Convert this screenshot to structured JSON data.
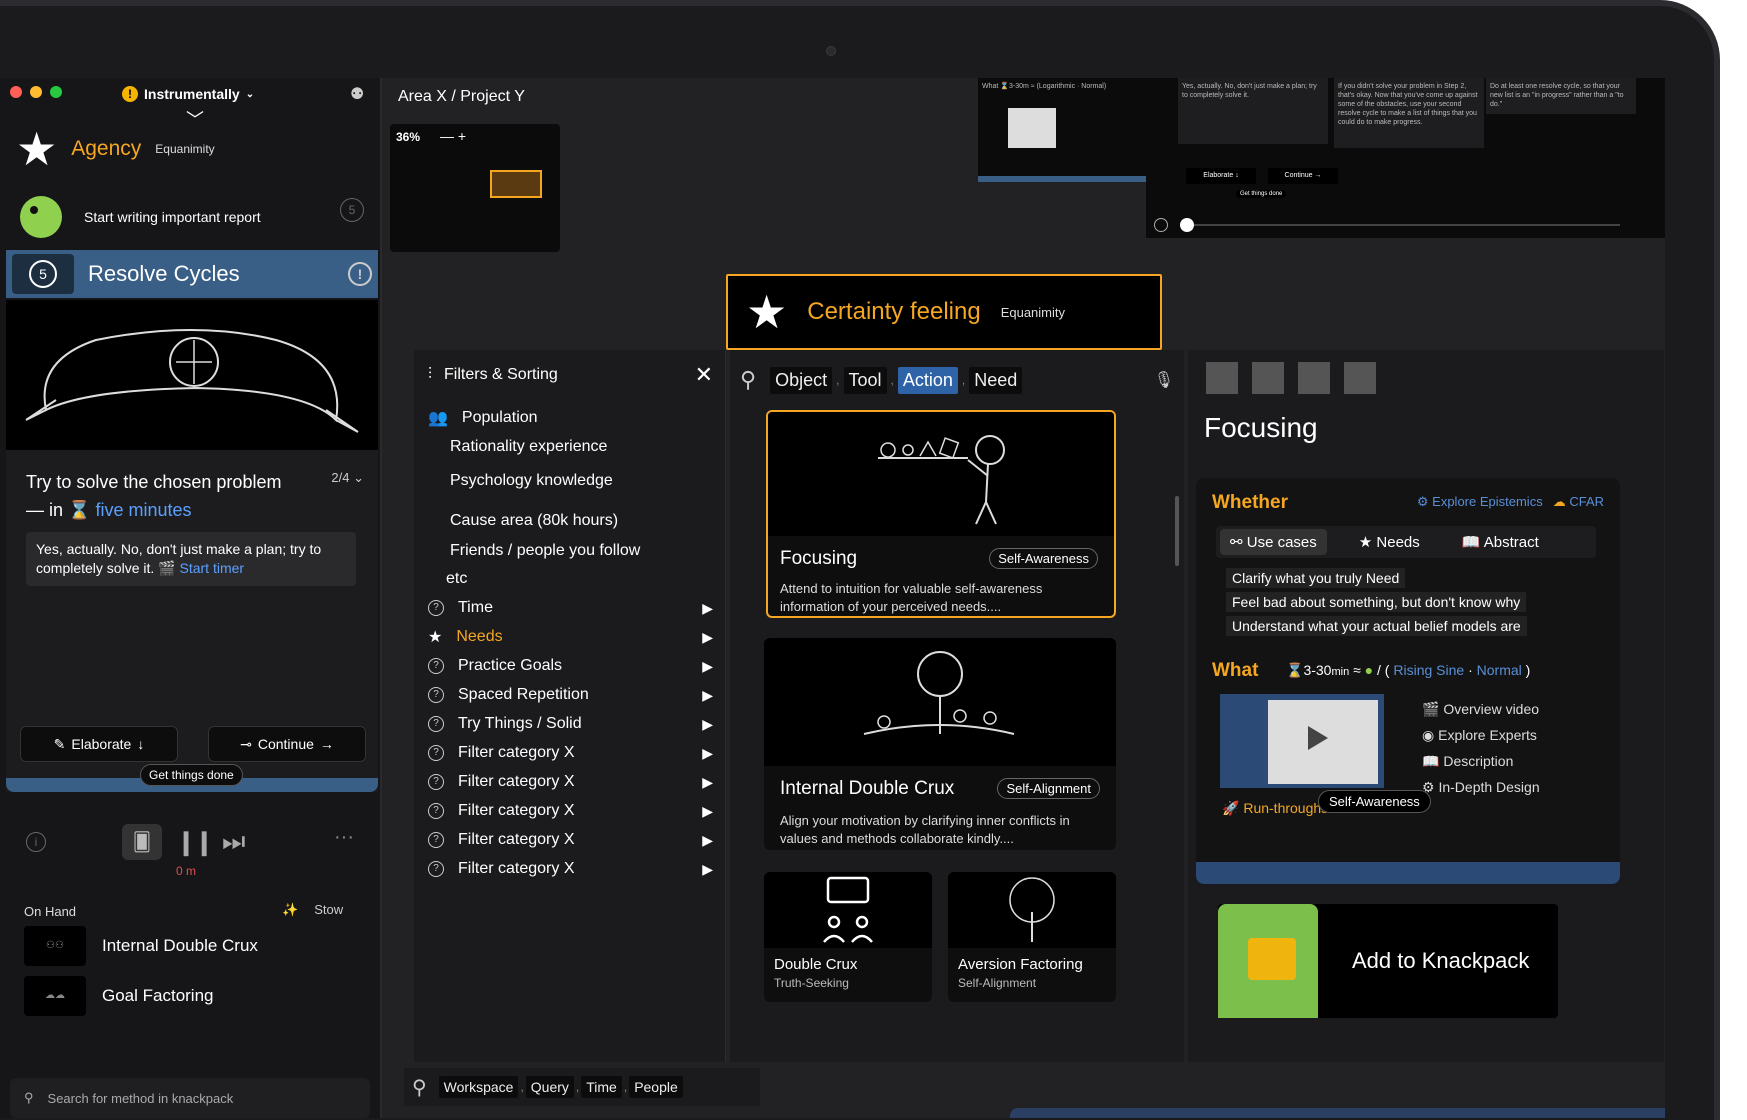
{
  "window": {
    "workspace_name": "Instrumentally",
    "traffic_colors": [
      "#ff5f57",
      "#febc2e",
      "#28c840"
    ]
  },
  "left": {
    "brand": {
      "title": "Agency",
      "subtitle": "Equanimity"
    },
    "next_task": {
      "label": "Start writing important report",
      "cycle_count": "5"
    },
    "resolve": {
      "label": "Resolve Cycles",
      "cycle_count": "5"
    },
    "task": {
      "title": "Try to solve the chosen problem",
      "title_prefix": "— in",
      "duration": "five minutes",
      "progress": "2/4",
      "note": "Yes, actually. No, don't just make a plan; try to completely solve it.",
      "timer_label": "Start timer"
    },
    "elaborate_label": "Elaborate",
    "continue_label": "Continue",
    "get_things_done": "Get things done",
    "player_time": "0 m",
    "on_hand_title": "On Hand",
    "stow_label": "Stow",
    "on_hand_items": [
      {
        "label": "Internal Double Crux"
      },
      {
        "label": "Goal Factoring"
      }
    ],
    "search_placeholder": "Search for method in knackpack"
  },
  "canvas": {
    "breadcrumb": "Area X / Project Y",
    "zoom": "36%",
    "zoom_controls": "—  +",
    "thumb1_text": "What ⌛3-30m ≈ (Logarithmic · Normal)",
    "thumb2_cols": [
      "Yes, actually. No, don't just make a plan; try to completely solve it.",
      "If you didn't solve your problem in Step 2, that's okay. Now that you've come up against some of the obstacles, use your second resolve cycle to make a list of things that you could do to make progress.",
      "Do at least one resolve cycle, so that your new list is an \"in progress\" rather than a \"to do.\""
    ],
    "thumb2_buttons": [
      "Elaborate ↓",
      "Continue →"
    ],
    "thumb2_gtd": "Get things done"
  },
  "certainty": {
    "title": "Certainty feeling",
    "subtitle": "Equanimity"
  },
  "filters": {
    "title": "Filters & Sorting",
    "population": "Population",
    "population_items": [
      "Rationality experience",
      "Psychology knowledge",
      "Cause area (80k hours)",
      "Friends / people you follow",
      "etc"
    ],
    "items": [
      {
        "label": "Time"
      },
      {
        "label": "Needs",
        "active": true
      },
      {
        "label": "Practice Goals"
      },
      {
        "label": "Spaced Repetition"
      },
      {
        "label": "Try Things / Solid"
      },
      {
        "label": "Filter category X"
      },
      {
        "label": "Filter category X"
      },
      {
        "label": "Filter category X"
      },
      {
        "label": "Filter category X"
      },
      {
        "label": "Filter category X"
      }
    ]
  },
  "search": {
    "chips": [
      "Object",
      "Tool",
      "Action",
      "Need"
    ],
    "active_chip": "Action"
  },
  "results": [
    {
      "title": "Focusing",
      "tag": "Self-Awareness",
      "desc": "Attend to intuition for valuable self-awareness information of your perceived needs...."
    },
    {
      "title": "Internal Double Crux",
      "tag": "Self-Alignment",
      "desc": "Align your motivation by clarifying inner conflicts in values and methods collaborate kindly...."
    },
    {
      "title": "Double Crux",
      "sub": "Truth-Seeking"
    },
    {
      "title": "Aversion Factoring",
      "sub": "Self-Alignment"
    }
  ],
  "detail": {
    "title": "Focusing",
    "whether": "Whether",
    "links": [
      "Explore Epistemics",
      "CFAR"
    ],
    "tabs": [
      "Use cases",
      "Needs",
      "Abstract"
    ],
    "use_cases": [
      "Clarify what you truly Need",
      "Feel bad about something, but don't know why",
      "Understand what your actual belief models are"
    ],
    "what": "What",
    "what_time": "3-30",
    "what_unit": "min",
    "what_curves": [
      "Rising Sine",
      "Normal"
    ],
    "resources": [
      "Overview video",
      "Explore Experts",
      "Description",
      "In-Depth Design"
    ],
    "runs": "Run-throughs · 3-10 min",
    "category": "Self-Awareness",
    "knackpack": "Add to Knackpack"
  },
  "bottom_search": {
    "chips": [
      "Workspace",
      "Query",
      "Time",
      "People"
    ]
  }
}
